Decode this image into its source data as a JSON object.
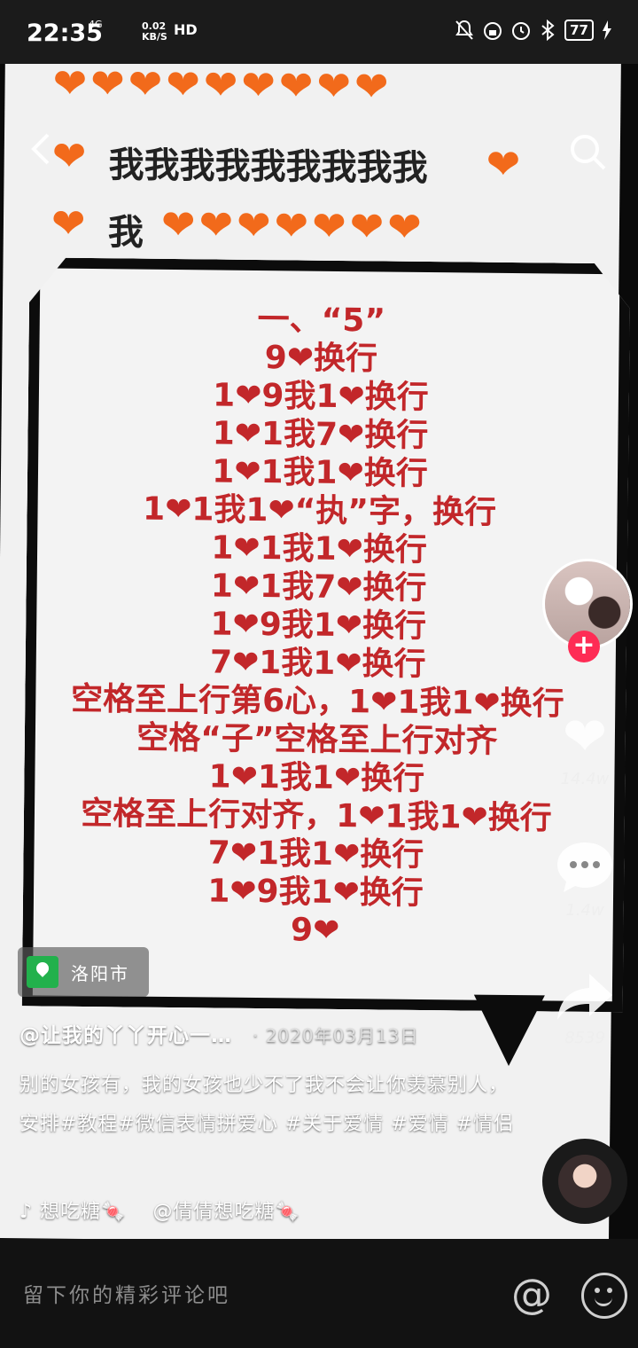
{
  "status_bar": {
    "time": "22:35",
    "network": "4G",
    "speed_value": "0.02",
    "speed_unit": "KB/S",
    "hd": "HD",
    "battery": "77"
  },
  "video": {
    "header_line_2": "我我我我我我我我我",
    "header_line_3": "我",
    "instructions": [
      "一、“5”",
      "9❤换行",
      "1❤9我1❤换行",
      "1❤1我7❤换行",
      "1❤1我1❤换行",
      "1❤1我1❤“执”字，换行",
      "1❤1我1❤换行",
      "1❤1我7❤换行",
      "1❤9我1❤换行",
      "7❤1我1❤换行",
      "空格至上行第6心，1❤1我1❤换行",
      "空格“子”空格至上行对齐",
      "1❤1我1❤换行",
      "空格至上行对齐，1❤1我1❤换行",
      "7❤1我1❤换行",
      "1❤9我1❤换行",
      "9❤"
    ]
  },
  "actions": {
    "like_count": "14.4w",
    "comment_count": "1.4w",
    "share_count": "8539"
  },
  "location": "洛阳市",
  "caption": {
    "author": "@让我的丫丫开心一…",
    "date": "· 2020年03月13日",
    "description": "别的女孩有，我的女孩也少不了我不会让你羡慕别人，安排#教程#微信表情拼爱心 #关于爱情 #爱情 #情侣",
    "music_left": "想吃糖🍬",
    "music_right": "@倩倩想吃糖🍬"
  },
  "comment_bar": {
    "placeholder": "留下你的精彩评论吧",
    "at_symbol": "@"
  }
}
